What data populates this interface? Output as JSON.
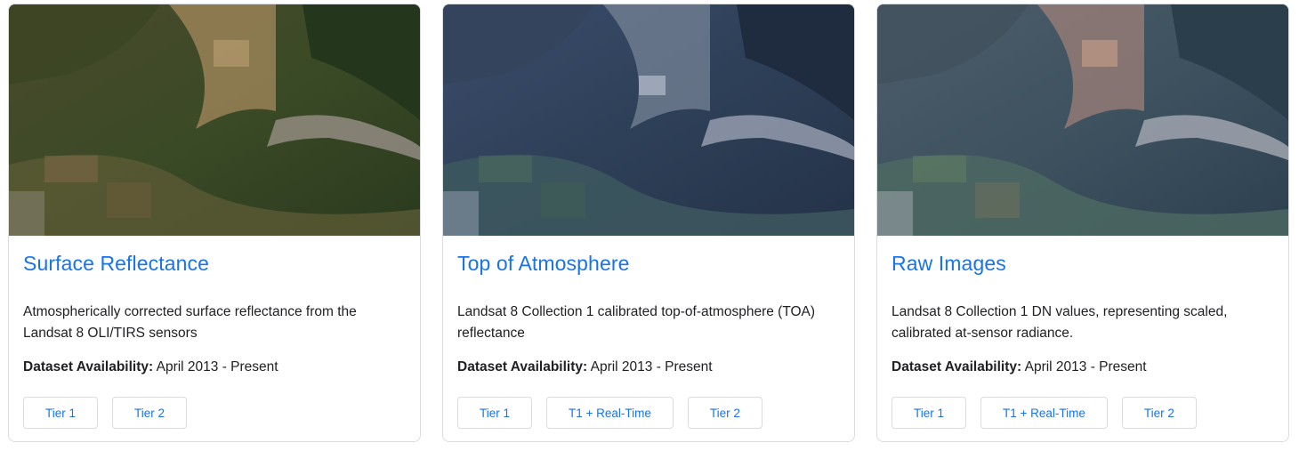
{
  "cards": [
    {
      "title": "Surface Reflectance",
      "description": "Atmospherically corrected surface reflectance from the Landsat 8 OLI/TIRS sensors",
      "availability_label": "Dataset Availability:",
      "availability_value": " April 2013 - Present",
      "buttons": [
        "Tier 1",
        "Tier 2"
      ],
      "image_tone": "natural-color"
    },
    {
      "title": "Top of Atmosphere",
      "description": "Landsat 8 Collection 1 calibrated top-of-atmosphere (TOA) reflectance",
      "availability_label": "Dataset Availability:",
      "availability_value": " April 2013 - Present",
      "buttons": [
        "Tier 1",
        "T1 + Real-Time",
        "Tier 2"
      ],
      "image_tone": "blue-haze"
    },
    {
      "title": "Raw Images",
      "description": "Landsat 8 Collection 1 DN values, representing scaled, calibrated at-sensor radiance.",
      "availability_label": "Dataset Availability:",
      "availability_value": " April 2013 - Present",
      "buttons": [
        "Tier 1",
        "T1 + Real-Time",
        "Tier 2"
      ],
      "image_tone": "raw-dn"
    }
  ],
  "colors": {
    "link": "#1a73e8",
    "border": "#dadce0",
    "text": "#202124"
  }
}
